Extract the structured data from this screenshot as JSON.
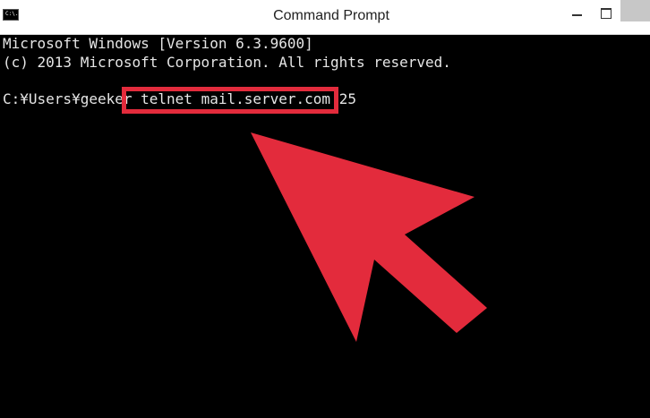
{
  "window": {
    "title": "Command Prompt",
    "icon_text": "C:\\.",
    "icon": "console-icon"
  },
  "titlebar": {
    "minimize_icon": "minimize-icon",
    "maximize_icon": "maximize-icon",
    "close_icon": "close-icon"
  },
  "console": {
    "lines": [
      "Microsoft Windows [Version 6.3.9600]",
      "(c) 2013 Microsoft Corporation. All rights reserved."
    ],
    "prompt": "C:¥Users¥geeker",
    "command": "telnet mail.server.com 25"
  },
  "annotation": {
    "color": "#e32b3c",
    "arrow_icon": "pointer-arrow-icon"
  }
}
